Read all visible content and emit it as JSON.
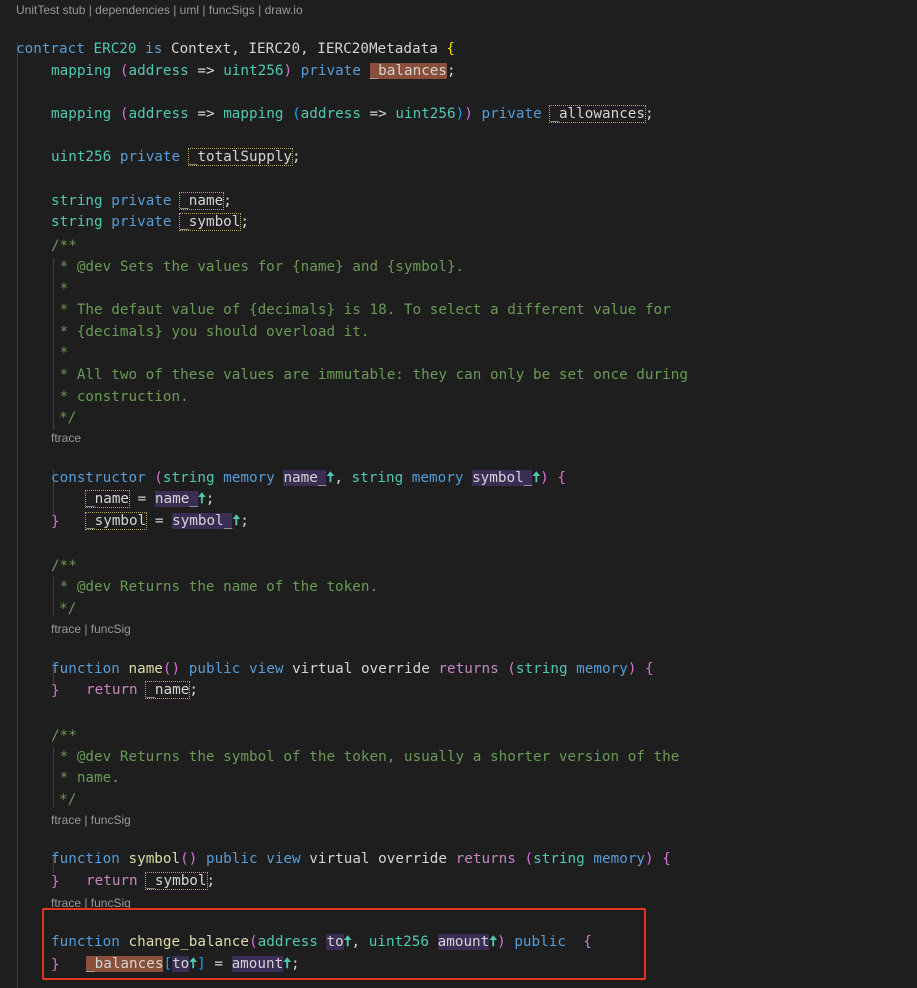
{
  "lens": {
    "top": "UnitTest stub | dependencies | uml | funcSigs | draw.io",
    "ctor": "ftrace",
    "name_fn": "ftrace | funcSig",
    "symbol_fn": "ftrace | funcSig",
    "change_fn": "ftrace | funcSig"
  },
  "code": {
    "contract_kw": "contract",
    "contract_name": "ERC20",
    "is_kw": "is",
    "bases": "Context, IERC20, IERC20Metadata",
    "open_brace": "{",
    "close_brace": "}",
    "mapping": "mapping",
    "address": "address",
    "arrow": "=>",
    "uint256": "uint256",
    "private": "private",
    "string": "string",
    "memory": "memory",
    "balances": "_balances",
    "allowances": "_allowances",
    "total_supply": "_totalSupply",
    "name_var": "_name",
    "symbol_var": "_symbol",
    "comment_open": "/**",
    "comment_close": "*/",
    "c1": " * @dev Sets the values for {name} and {symbol}.",
    "c2": " *",
    "c3": " * The defaut value of {decimals} is 18. To select a different value for",
    "c4": " * {decimals} you should overload it.",
    "c5": " *",
    "c6": " * All two of these values are immutable: they can only be set once during",
    "c7": " * construction.",
    "constructor_kw": "constructor",
    "param_name": "name_",
    "param_symbol": "symbol_",
    "up_arrow": "🠅",
    "c8": " * @dev Returns the name of the token.",
    "function_kw": "function",
    "fn_name": "name",
    "public": "public",
    "view": "view",
    "virtual": "virtual",
    "override": "override",
    "returns": "returns",
    "return_kw": "return",
    "c9": " * @dev Returns the symbol of the token, usually a shorter version of the",
    "c10": " * name.",
    "fn_symbol": "symbol",
    "fn_change": "change_balance",
    "param_to": "to",
    "param_amount": "amount"
  },
  "colors": {
    "highlight_box": "#e2371f",
    "background": "#1e1e1e"
  }
}
